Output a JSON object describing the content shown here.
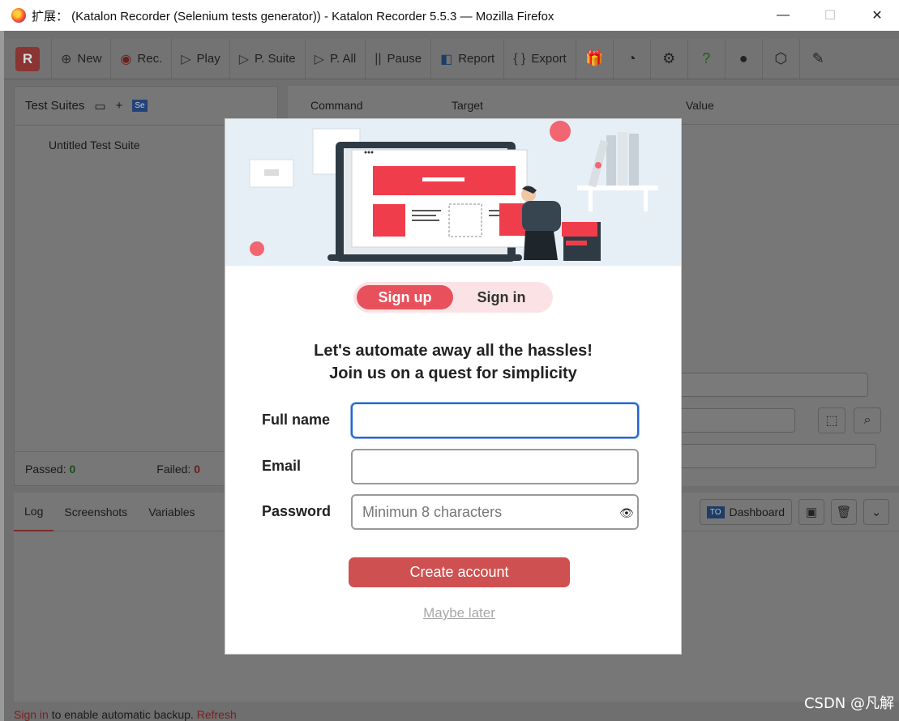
{
  "window": {
    "title": "扩展：  (Katalon Recorder (Selenium tests generator)) - Katalon Recorder 5.5.3 — Mozilla Firefox",
    "minimize": "—",
    "maximize": "☐",
    "close": "✕"
  },
  "toolbar": {
    "logo": "R",
    "buttons": [
      {
        "icon": "⊕",
        "label": "New"
      },
      {
        "icon": "◉",
        "label": "Rec."
      },
      {
        "icon": "▷",
        "label": "Play"
      },
      {
        "icon": "▷",
        "label": "P. Suite"
      },
      {
        "icon": "▷",
        "label": "P. All"
      },
      {
        "icon": "||",
        "label": "Pause"
      },
      {
        "icon": "◧",
        "label": "Report"
      },
      {
        "icon": "{ }",
        "label": "Export"
      }
    ]
  },
  "suites": {
    "title": "Test Suites",
    "items": [
      "Untitled Test Suite"
    ],
    "passed_label": "Passed:",
    "passed_value": "0",
    "failed_label": "Failed:",
    "failed_value": "0"
  },
  "commands": {
    "col_command": "Command",
    "col_target": "Target",
    "col_value": "Value"
  },
  "log": {
    "tabs": [
      "Log",
      "Screenshots",
      "Variables"
    ],
    "dashboard_label": "Dashboard",
    "footer_link": "Sign in",
    "footer_text": " to enable automatic backup.",
    "footer_refresh": "Refresh"
  },
  "modal": {
    "tab_signup": "Sign up",
    "tab_signin": "Sign in",
    "headline_line1": "Let's automate away all the hassles!",
    "headline_line2": "Join us on a quest for simplicity",
    "fullname_label": "Full name",
    "fullname_value": "",
    "email_label": "Email",
    "email_value": "",
    "password_label": "Password",
    "password_placeholder": "Minimun 8 characters",
    "create_button": "Create account",
    "maybe_later": "Maybe later",
    "accent_color": "#e8515c"
  },
  "watermark": "CSDN @凡解"
}
